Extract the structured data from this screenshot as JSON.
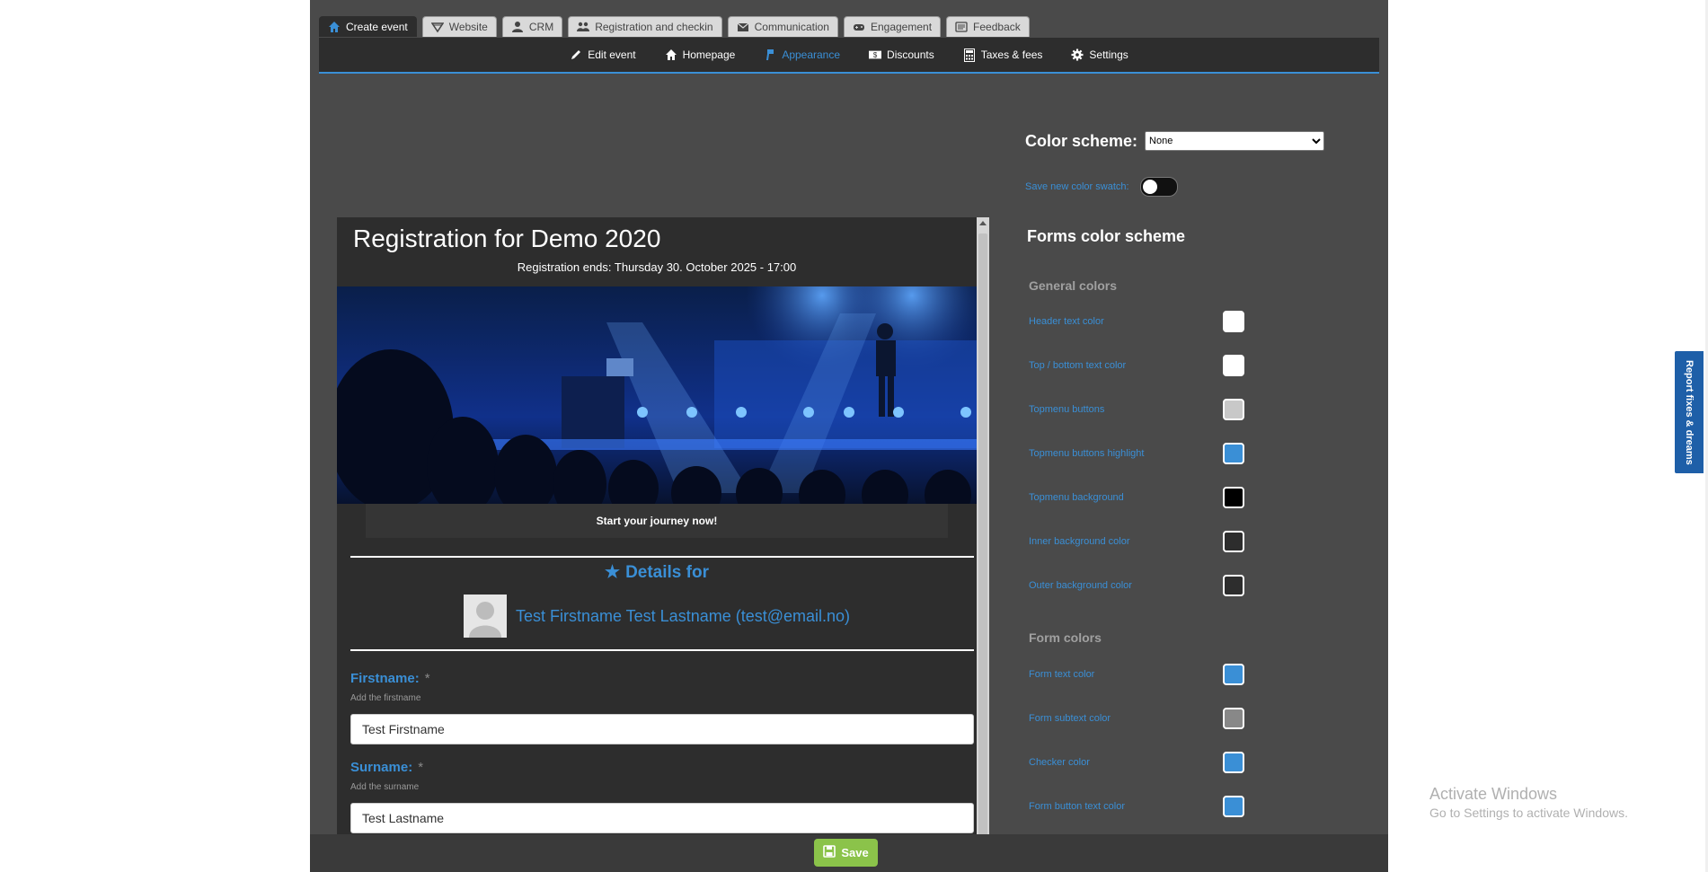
{
  "main_tabs": [
    {
      "label": "Create event",
      "icon": "home-icon",
      "active": true
    },
    {
      "label": "Website",
      "icon": "website-icon",
      "active": false
    },
    {
      "label": "CRM",
      "icon": "user-icon",
      "active": false
    },
    {
      "label": "Registration and checkin",
      "icon": "users-icon",
      "active": false
    },
    {
      "label": "Communication",
      "icon": "envelope-icon",
      "active": false
    },
    {
      "label": "Engagement",
      "icon": "gamepad-icon",
      "active": false
    },
    {
      "label": "Feedback",
      "icon": "feedback-icon",
      "active": false
    }
  ],
  "sub_nav": [
    {
      "label": "Edit event",
      "icon": "pencil-icon",
      "active": false
    },
    {
      "label": "Homepage",
      "icon": "home-icon",
      "active": false
    },
    {
      "label": "Appearance",
      "icon": "brush-icon",
      "active": true
    },
    {
      "label": "Discounts",
      "icon": "money-icon",
      "active": false
    },
    {
      "label": "Taxes & fees",
      "icon": "calculator-icon",
      "active": false
    },
    {
      "label": "Settings",
      "icon": "gear-icon",
      "active": false
    }
  ],
  "color_scheme": {
    "label": "Color scheme:",
    "selected": "None"
  },
  "save_swatch": {
    "label": "Save new color swatch:",
    "enabled": false
  },
  "forms_title": "Forms color scheme",
  "general_colors": {
    "title": "General colors",
    "items": [
      {
        "label": "Header text color",
        "color": "#ffffff"
      },
      {
        "label": "Top / bottom text color",
        "color": "#ffffff"
      },
      {
        "label": "Topmenu buttons",
        "color": "#c8c8c8"
      },
      {
        "label": "Topmenu buttons highlight",
        "color": "#3a8fd6"
      },
      {
        "label": "Topmenu background",
        "color": "#000000"
      },
      {
        "label": "Inner background color",
        "color": "#2d2d2d"
      },
      {
        "label": "Outer background color",
        "color": "#2d2d2d"
      }
    ]
  },
  "form_colors": {
    "title": "Form colors",
    "items": [
      {
        "label": "Form text color",
        "color": "#3a8fd6"
      },
      {
        "label": "Form subtext color",
        "color": "#888888"
      },
      {
        "label": "Checker color",
        "color": "#3a8fd6"
      },
      {
        "label": "Form button text color",
        "color": "#3a8fd6"
      }
    ]
  },
  "preview": {
    "title": "Registration for Demo 2020",
    "ends": "Registration ends: Thursday 30. October 2025 - 17:00",
    "journey": "Start your journey now!",
    "details_label": "Details for",
    "person": "Test Firstname Test Lastname (test@email.no)",
    "fields": [
      {
        "label": "Firstname:",
        "required": "*",
        "hint": "Add the firstname",
        "value": "Test Firstname"
      },
      {
        "label": "Surname:",
        "required": "*",
        "hint": "Add the surname",
        "value": "Test Lastname"
      }
    ]
  },
  "save_label": "Save",
  "report_tab": "Report fixes & dreams",
  "windows_notice": {
    "title": "Activate Windows",
    "subtitle": "Go to Settings to activate Windows."
  }
}
